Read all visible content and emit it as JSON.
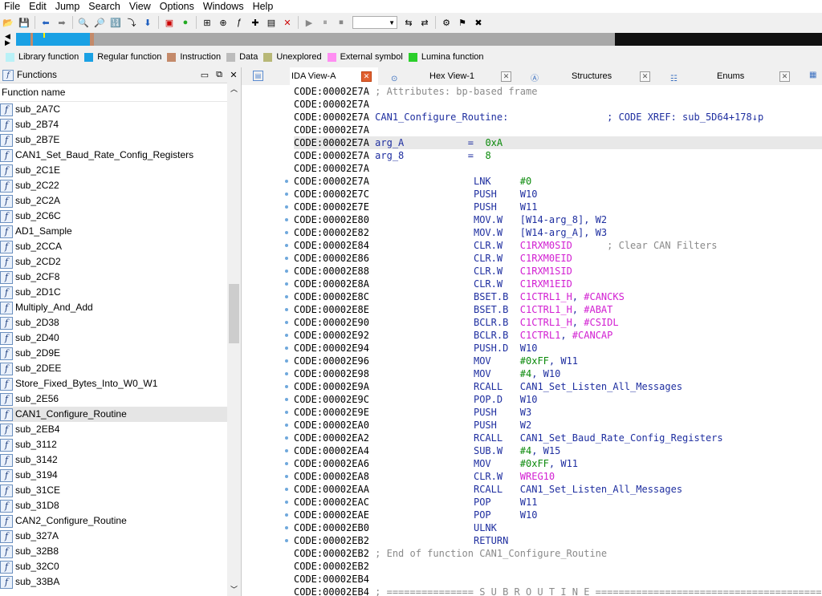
{
  "menu": [
    "File",
    "Edit",
    "Jump",
    "Search",
    "View",
    "Options",
    "Windows",
    "Help"
  ],
  "toolbar_icons": [
    "open-icon",
    "save-icon",
    "back-icon",
    "forward-icon",
    "find-icon",
    "search-binary-icon",
    "search-text-icon",
    "search-imm-icon",
    "jump-icon",
    "flag-icon",
    "stop-icon",
    "green-dot-icon",
    "graph-icon",
    "flow-icon",
    "xref-icon",
    "add-icon",
    "function-icon",
    "delete-icon",
    "play-icon",
    "pause-icon",
    "stop-debug-icon",
    "attach-icon",
    "detach-icon",
    "settings-icon",
    "plugin-icon",
    "tools-icon"
  ],
  "legend": [
    {
      "label": "Library function",
      "color": "#b9f1f7"
    },
    {
      "label": "Regular function",
      "color": "#1aa1e4"
    },
    {
      "label": "Instruction",
      "color": "#c48a6a"
    },
    {
      "label": "Data",
      "color": "#bcbcbc"
    },
    {
      "label": "Unexplored",
      "color": "#b8b877"
    },
    {
      "label": "External symbol",
      "color": "#ff8ef2"
    },
    {
      "label": "Lumina function",
      "color": "#2bcf2b"
    }
  ],
  "functions_panel": {
    "title": "Functions",
    "column": "Function name",
    "items": [
      "sub_2A7C",
      "sub_2B74",
      "sub_2B7E",
      "CAN1_Set_Baud_Rate_Config_Registers",
      "sub_2C1E",
      "sub_2C22",
      "sub_2C2A",
      "sub_2C6C",
      "AD1_Sample",
      "sub_2CCA",
      "sub_2CD2",
      "sub_2CF8",
      "sub_2D1C",
      "Multiply_And_Add",
      "sub_2D38",
      "sub_2D40",
      "sub_2D9E",
      "sub_2DEE",
      "Store_Fixed_Bytes_Into_W0_W1",
      "sub_2E56",
      "CAN1_Configure_Routine",
      "sub_2EB4",
      "sub_3112",
      "sub_3142",
      "sub_3194",
      "sub_31CE",
      "sub_31D8",
      "CAN2_Configure_Routine",
      "sub_327A",
      "sub_32B8",
      "sub_32C0",
      "sub_33BA"
    ],
    "selected": "CAN1_Configure_Routine"
  },
  "tabs": [
    {
      "label": "IDA View-A"
    },
    {
      "label": "Hex View-1"
    },
    {
      "label": "Structures"
    },
    {
      "label": "Enums"
    }
  ],
  "disasm": [
    {
      "addr": "CODE:00002E7A",
      "comment": " ; Attributes: bp-based frame"
    },
    {
      "addr": "CODE:00002E7A"
    },
    {
      "addr": "CODE:00002E7A",
      "label": " CAN1_Configure_Routine:",
      "xref": "                 ; CODE XREF: sub_5D64+178↓p"
    },
    {
      "addr": "CODE:00002E7A"
    },
    {
      "addr": "CODE:00002E7A",
      "hl": true,
      "label": " arg_A",
      "opd": "           =  ",
      "imm": "0xA"
    },
    {
      "addr": "CODE:00002E7A",
      "label": " arg_8",
      "opd": "           =  ",
      "imm": "8"
    },
    {
      "addr": "CODE:00002E7A"
    },
    {
      "addr": "CODE:00002E7A",
      "dot": true,
      "mnem": "LNK",
      "imm1": "#0"
    },
    {
      "addr": "CODE:00002E7C",
      "dot": true,
      "mnem": "PUSH",
      "op": "W10"
    },
    {
      "addr": "CODE:00002E7E",
      "dot": true,
      "mnem": "PUSH",
      "op": "W11"
    },
    {
      "addr": "CODE:00002E80",
      "dot": true,
      "mnem": "MOV.W",
      "op": "[W14-arg_8], W2"
    },
    {
      "addr": "CODE:00002E82",
      "dot": true,
      "mnem": "MOV.W",
      "op": "[W14-arg_A], W3"
    },
    {
      "addr": "CODE:00002E84",
      "dot": true,
      "mnem": "CLR.W",
      "sfr": "C1RXM0SID",
      "cmt": "      ; Clear CAN Filters"
    },
    {
      "addr": "CODE:00002E86",
      "dot": true,
      "mnem": "CLR.W",
      "sfr": "C1RXM0EID"
    },
    {
      "addr": "CODE:00002E88",
      "dot": true,
      "mnem": "CLR.W",
      "sfr": "C1RXM1SID"
    },
    {
      "addr": "CODE:00002E8A",
      "dot": true,
      "mnem": "CLR.W",
      "sfr": "C1RXM1EID"
    },
    {
      "addr": "CODE:00002E8C",
      "dot": true,
      "mnem": "BSET.B",
      "sfr": "C1CTRL1_H",
      "op2": ", ",
      "sfr2": "#CANCKS"
    },
    {
      "addr": "CODE:00002E8E",
      "dot": true,
      "mnem": "BSET.B",
      "sfr": "C1CTRL1_H",
      "op2": ", ",
      "sfr2": "#ABAT"
    },
    {
      "addr": "CODE:00002E90",
      "dot": true,
      "mnem": "BCLR.B",
      "sfr": "C1CTRL1_H",
      "op2": ", ",
      "sfr2": "#CSIDL"
    },
    {
      "addr": "CODE:00002E92",
      "dot": true,
      "mnem": "BCLR.B",
      "sfr": "C1CTRL1",
      "op2": ", ",
      "sfr2": "#CANCAP"
    },
    {
      "addr": "CODE:00002E94",
      "dot": true,
      "mnem": "PUSH.D",
      "op": "W10"
    },
    {
      "addr": "CODE:00002E96",
      "dot": true,
      "mnem": "MOV",
      "imm1": "#0xFF",
      "op2": ", W11"
    },
    {
      "addr": "CODE:00002E98",
      "dot": true,
      "mnem": "MOV",
      "imm1": "#4",
      "op2": ", W10"
    },
    {
      "addr": "CODE:00002E9A",
      "dot": true,
      "mnem": "RCALL",
      "op": "CAN1_Set_Listen_All_Messages"
    },
    {
      "addr": "CODE:00002E9C",
      "dot": true,
      "mnem": "POP.D",
      "op": "W10"
    },
    {
      "addr": "CODE:00002E9E",
      "dot": true,
      "mnem": "PUSH",
      "op": "W3"
    },
    {
      "addr": "CODE:00002EA0",
      "dot": true,
      "mnem": "PUSH",
      "op": "W2"
    },
    {
      "addr": "CODE:00002EA2",
      "dot": true,
      "mnem": "RCALL",
      "op": "CAN1_Set_Baud_Rate_Config_Registers"
    },
    {
      "addr": "CODE:00002EA4",
      "dot": true,
      "mnem": "SUB.W",
      "imm1": "#4",
      "op2": ", W15"
    },
    {
      "addr": "CODE:00002EA6",
      "dot": true,
      "mnem": "MOV",
      "imm1": "#0xFF",
      "op2": ", W11"
    },
    {
      "addr": "CODE:00002EA8",
      "dot": true,
      "mnem": "CLR.W",
      "sfr": "WREG10"
    },
    {
      "addr": "CODE:00002EAA",
      "dot": true,
      "mnem": "RCALL",
      "op": "CAN1_Set_Listen_All_Messages"
    },
    {
      "addr": "CODE:00002EAC",
      "dot": true,
      "mnem": "POP",
      "op": "W11"
    },
    {
      "addr": "CODE:00002EAE",
      "dot": true,
      "mnem": "POP",
      "op": "W10"
    },
    {
      "addr": "CODE:00002EB0",
      "dot": true,
      "mnem": "ULNK"
    },
    {
      "addr": "CODE:00002EB2",
      "dot": true,
      "mnem": "RETURN"
    },
    {
      "addr": "CODE:00002EB2",
      "comment": " ; End of function CAN1_Configure_Routine"
    },
    {
      "addr": "CODE:00002EB2"
    },
    {
      "addr": "CODE:00002EB4"
    },
    {
      "addr": "CODE:00002EB4",
      "comment": " ; =============== S U B R O U T I N E ======================================="
    }
  ]
}
